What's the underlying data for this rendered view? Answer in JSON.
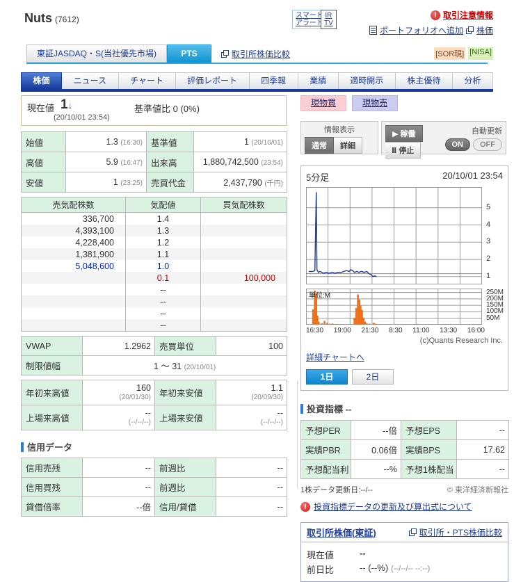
{
  "icons": {
    "exclamation": "!",
    "down_arrow": "↓",
    "play": "▶",
    "pause": "Ⅱ"
  },
  "header": {
    "title": "Nuts",
    "code": "(7612)",
    "smart_alert_line1": "スマート",
    "smart_alert_line2": "アラート",
    "irtv_line1": "IR",
    "irtv_line2": "TV",
    "caution_link": "取引注意情報",
    "portfolio_link": "ポートフォリオへ追加",
    "price_link": "株価"
  },
  "market_bar": {
    "market_tab": "東証JASDAQ・S(当社優先市場)",
    "pts_tab": "PTS",
    "compare_link": "取引所株価比較",
    "badge_sor": "[SOR現]",
    "badge_nisa": "[NISA]"
  },
  "nav_tabs": [
    "株価",
    "ニュース",
    "チャート",
    "評価レポート",
    "四季報",
    "業績",
    "適時開示",
    "株主優待",
    "分析"
  ],
  "quote": {
    "label": "現在値",
    "price": "1",
    "timestamp": "(20/10/01 23:54)",
    "change_label": "基準値比",
    "change_value": "0 (0%)"
  },
  "actions": {
    "buy": "現物買",
    "sell": "現物売"
  },
  "controls": {
    "info_label": "情報表示",
    "normal": "通常",
    "detail": "詳細",
    "run": "稼働",
    "stop": "停止",
    "auto_label": "自動更新",
    "on": "ON",
    "off": "OFF"
  },
  "summary": {
    "rows": [
      {
        "l1": "始値",
        "v1": "1.3",
        "s1": "(16:30)",
        "l2": "基準値",
        "v2": "1",
        "s2": "(20/10/01)"
      },
      {
        "l1": "高値",
        "v1": "5.9",
        "s1": "(16:47)",
        "l2": "出来高",
        "v2": "1,880,742,500",
        "s2": "(23:54)"
      },
      {
        "l1": "安値",
        "v1": "1",
        "s1": "(23:25)",
        "l2": "売買代金",
        "v2": "2,437,790",
        "s2": "(千円)"
      }
    ]
  },
  "order_book": {
    "headers": [
      "売気配株数",
      "気配値",
      "買気配株数"
    ],
    "rows": [
      {
        "sell": "336,700",
        "price": "1.4",
        "buy": ""
      },
      {
        "sell": "4,393,100",
        "price": "1.3",
        "buy": ""
      },
      {
        "sell": "4,228,400",
        "price": "1.2",
        "buy": ""
      },
      {
        "sell": "1,381,900",
        "price": "1.1",
        "buy": ""
      },
      {
        "sell": "5,048,600",
        "price": "1.0",
        "buy": ""
      },
      {
        "sell": "",
        "price": "0.1",
        "buy": "100,000"
      },
      {
        "sell": "",
        "price": "--",
        "buy": ""
      },
      {
        "sell": "",
        "price": "--",
        "buy": ""
      },
      {
        "sell": "",
        "price": "--",
        "buy": ""
      },
      {
        "sell": "",
        "price": "--",
        "buy": ""
      }
    ]
  },
  "vwap": {
    "vwap_label": "VWAP",
    "vwap": "1.2962",
    "unit_label": "売買単位",
    "unit": "100",
    "limit_label": "制限値幅",
    "limit": "1 ～ 31",
    "limit_suffix": "(20/10/01)"
  },
  "range": {
    "rows": [
      {
        "l1": "年初来高値",
        "v1": "160",
        "d1": "(20/01/30)",
        "l2": "年初来安値",
        "v2": "1.1",
        "d2": "(20/09/30)"
      },
      {
        "l1": "上場来高値",
        "v1": "--",
        "d1": "(--/--/--)",
        "l2": "上場来安値",
        "v2": "--",
        "d2": "(--/--/--)"
      }
    ]
  },
  "credit": {
    "heading": "信用データ",
    "rows": [
      {
        "l1": "信用売残",
        "v1": "--",
        "l2": "前週比",
        "v2": "--"
      },
      {
        "l1": "信用買残",
        "v1": "--",
        "l2": "前週比",
        "v2": "--"
      },
      {
        "l1": "貸借倍率",
        "v1": "--倍",
        "l2": "信用/貸借",
        "v2": "--"
      }
    ]
  },
  "chart": {
    "title": "5分足",
    "timestamp": "20/10/01 23:54",
    "unit_label": "単位:M",
    "copyright": "(c)Quants Research Inc.",
    "detail_link": "詳細チャートへ",
    "btn_1d": "1日",
    "btn_2d": "2日"
  },
  "chart_data": {
    "type": "line",
    "title": "5分足",
    "timestamp": "20/10/01 23:54",
    "x_labels": [
      "16:30",
      "19:00",
      "21:30",
      "8:30",
      "11:00",
      "13:30",
      "16:00"
    ],
    "price_axis": {
      "ticks": [
        5,
        4,
        3,
        2,
        1
      ],
      "min": 0.55,
      "max": 6.2
    },
    "reference_line": 1.17,
    "price_series": [
      [
        0.015,
        1.3
      ],
      [
        0.04,
        1.3
      ],
      [
        0.05,
        1.35
      ],
      [
        0.058,
        5.9
      ],
      [
        0.062,
        1.4
      ],
      [
        0.07,
        1.25
      ],
      [
        0.08,
        1.3
      ],
      [
        0.1,
        1.2
      ],
      [
        0.115,
        1.25
      ],
      [
        0.13,
        1.2
      ],
      [
        0.15,
        1.25
      ],
      [
        0.165,
        1.2
      ],
      [
        0.18,
        1.25
      ],
      [
        0.2,
        1.25
      ],
      [
        0.215,
        1.3
      ],
      [
        0.23,
        1.35
      ],
      [
        0.245,
        1.3
      ],
      [
        0.255,
        1.4
      ],
      [
        0.265,
        1.35
      ],
      [
        0.275,
        1.25
      ],
      [
        0.29,
        1.3
      ],
      [
        0.3,
        1.25
      ],
      [
        0.315,
        1.3
      ],
      [
        0.33,
        1.25
      ],
      [
        0.345,
        1.3
      ],
      [
        0.355,
        1.2
      ],
      [
        0.362,
        1.15
      ],
      [
        0.372,
        1.1
      ],
      [
        0.38,
        1.0
      ],
      [
        0.39,
        1.05
      ],
      [
        0.4,
        1.0
      ]
    ],
    "volume_axis": {
      "ticks": [
        "250M",
        "200M",
        "150M",
        "100M",
        "50M"
      ],
      "max": 280
    },
    "volume_bars": [
      [
        0.04,
        120
      ],
      [
        0.05,
        265
      ],
      [
        0.058,
        240
      ],
      [
        0.065,
        70
      ],
      [
        0.072,
        25
      ],
      [
        0.09,
        12
      ],
      [
        0.105,
        30
      ],
      [
        0.12,
        15
      ],
      [
        0.135,
        8
      ],
      [
        0.15,
        10
      ],
      [
        0.17,
        6
      ],
      [
        0.275,
        55
      ],
      [
        0.285,
        130
      ],
      [
        0.295,
        235
      ],
      [
        0.303,
        195
      ],
      [
        0.31,
        150
      ],
      [
        0.318,
        115
      ],
      [
        0.327,
        55
      ],
      [
        0.335,
        25
      ],
      [
        0.345,
        10
      ],
      [
        0.36,
        8
      ],
      [
        0.385,
        15
      ],
      [
        0.395,
        8
      ],
      [
        0.41,
        5
      ]
    ]
  },
  "indicators": {
    "heading": "投資指標 --",
    "rows": [
      {
        "l1": "予想PER",
        "v1": "--倍",
        "l2": "予想EPS",
        "v2": "--"
      },
      {
        "l1": "実績PBR",
        "v1": "0.06倍",
        "l2": "実績BPS",
        "v2": "17.62"
      },
      {
        "l1": "予想配当利",
        "v1": "--%",
        "l2": "予想1株配当",
        "v2": "--"
      }
    ],
    "update_note": "1株データ更新日:--/--",
    "source": "© 東洋経済新報社",
    "formula_link": "投資指標データの更新及び算出式について"
  },
  "exchange": {
    "title": "取引所株価(東証)",
    "compare_link": "取引所・PTS株価比較",
    "row1_label": "現在値",
    "row1_value": "--",
    "row2_label": "前日比",
    "row2_value": "-- (--%)",
    "row2_suffix": "(--/--/-- --:--)"
  }
}
